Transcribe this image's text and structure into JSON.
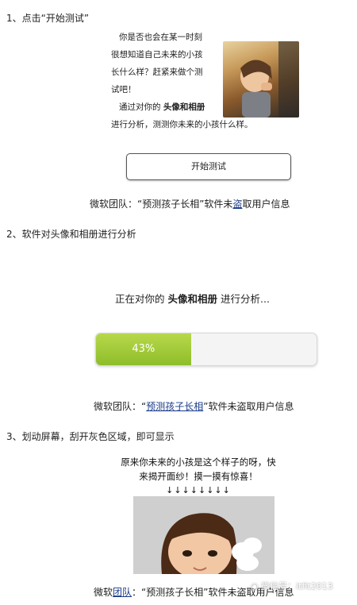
{
  "steps": {
    "s1": "1、点击“开始测试”",
    "s2": "2、软件对头像和相册进行分析",
    "s3": "3、划动屏幕，刮开灰色区域，即可显示"
  },
  "intro": {
    "line1": "你是否也会在某一时刻",
    "line2": "很想知道自己未来的小孩",
    "line3": "长什么样？赶紧来做个测",
    "line4": "试吧！",
    "line5_prefix": "通过对你的",
    "line5_bold": "头像和相册",
    "line6": "进行分析，测测你未来的小孩什么样。"
  },
  "start_button": "开始测试",
  "caption": {
    "prefix": "微软团队：“预测孩子长相”软件未",
    "steal": "盗",
    "suffix": "取用户信息",
    "c2_prefix": "微软团队：“",
    "c2_link": "预测孩子长相",
    "c2_suffix": "”软件未盗取用户信息",
    "c3_a": "微软",
    "c3_b": "团队",
    "c3_c": "：“预测孩子长相”软件未盗取用户信息"
  },
  "analysis": {
    "prefix": "正在对你的",
    "bold": "头像和相册",
    "suffix": "进行分析..."
  },
  "progress": {
    "value": 0.43,
    "label": "43%"
  },
  "reveal": {
    "line1": "原来你未来的小孩是这个样子的呀，快",
    "line2": "来揭开面纱！摸一摸有惊喜！",
    "arrows": "↓↓↓↓↓↓↓↓"
  },
  "watermark": "微信号：itfit2013",
  "colors": {
    "progress_fill": "#9cc736",
    "link": "#1a3b8a"
  }
}
